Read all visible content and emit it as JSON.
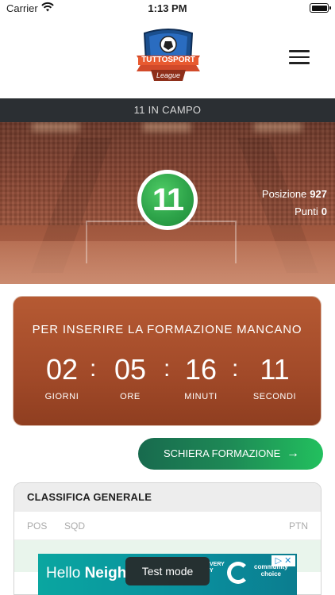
{
  "status_bar": {
    "carrier": "Carrier",
    "time": "1:13 PM"
  },
  "header": {
    "logo_icon": "tuttosport-league-logo",
    "logo_text": "TUTTOSPORT",
    "logo_subtext": "League",
    "menu_icon": "hamburger-menu-icon"
  },
  "title_bar": {
    "title": "11 IN CAMPO"
  },
  "hero": {
    "badge_text": "11",
    "position_label": "Posizione",
    "position_value": "927",
    "points_label": "Punti",
    "points_value": "0"
  },
  "countdown": {
    "label": "PER INSERIRE LA FORMAZIONE MANCANO",
    "units": [
      {
        "value": "02",
        "caption": "GIORNI"
      },
      {
        "value": "05",
        "caption": "ORE"
      },
      {
        "value": "16",
        "caption": "MINUTI"
      },
      {
        "value": "11",
        "caption": "SECONDI"
      }
    ],
    "separator": ":"
  },
  "cta": {
    "label": "SCHIERA FORMAZIONE",
    "arrow": "→"
  },
  "ranking": {
    "title": "CLASSIFICA GENERALE",
    "columns": {
      "pos": "POS",
      "sqd": "SQD",
      "ptn": "PTN"
    }
  },
  "ad": {
    "text_regular": "Hello ",
    "text_bold": "Neigh",
    "side_text": "VERY\nY",
    "brand": "community\nchoice",
    "close": "▷ ✕"
  },
  "toast": {
    "text": "Test mode"
  },
  "colors": {
    "title_bar": "#2b2f33",
    "countdown_bg": "#a24a29",
    "cta_start": "#186a4e",
    "cta_end": "#22c05e",
    "badge_green": "#2ea44a"
  }
}
